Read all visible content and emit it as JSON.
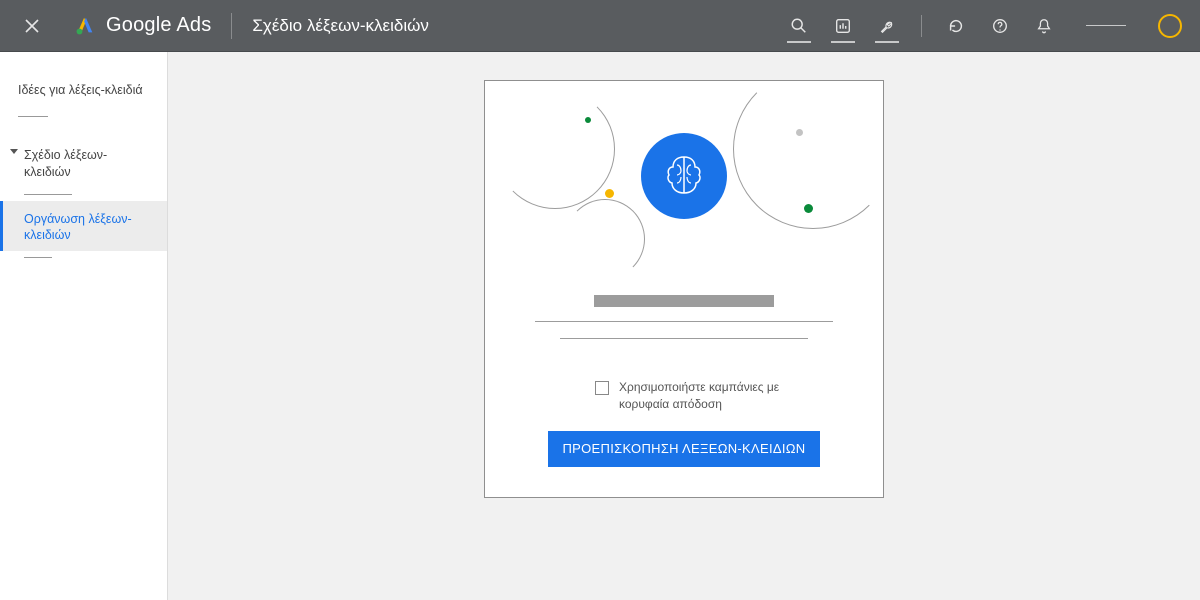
{
  "header": {
    "brand": "Google Ads",
    "page_title": "Σχέδιο λέξεων-κλειδιών"
  },
  "sidebar": {
    "ideas_label": "Ιδέες για λέξεις-κλειδιά",
    "plan_label": "Σχέδιο λέξεων-κλειδιών",
    "organize_label": "Οργάνωση λέξεων-κλειδιών"
  },
  "card": {
    "checkbox_label": "Χρησιμοποιήστε καμπάνιες με κορυφαία απόδοση",
    "preview_button": "ΠΡΟΕΠΙΣΚΟΠΗΣΗ ΛΕΞΕΩΝ-ΚΛΕΙΔΙΩΝ"
  }
}
